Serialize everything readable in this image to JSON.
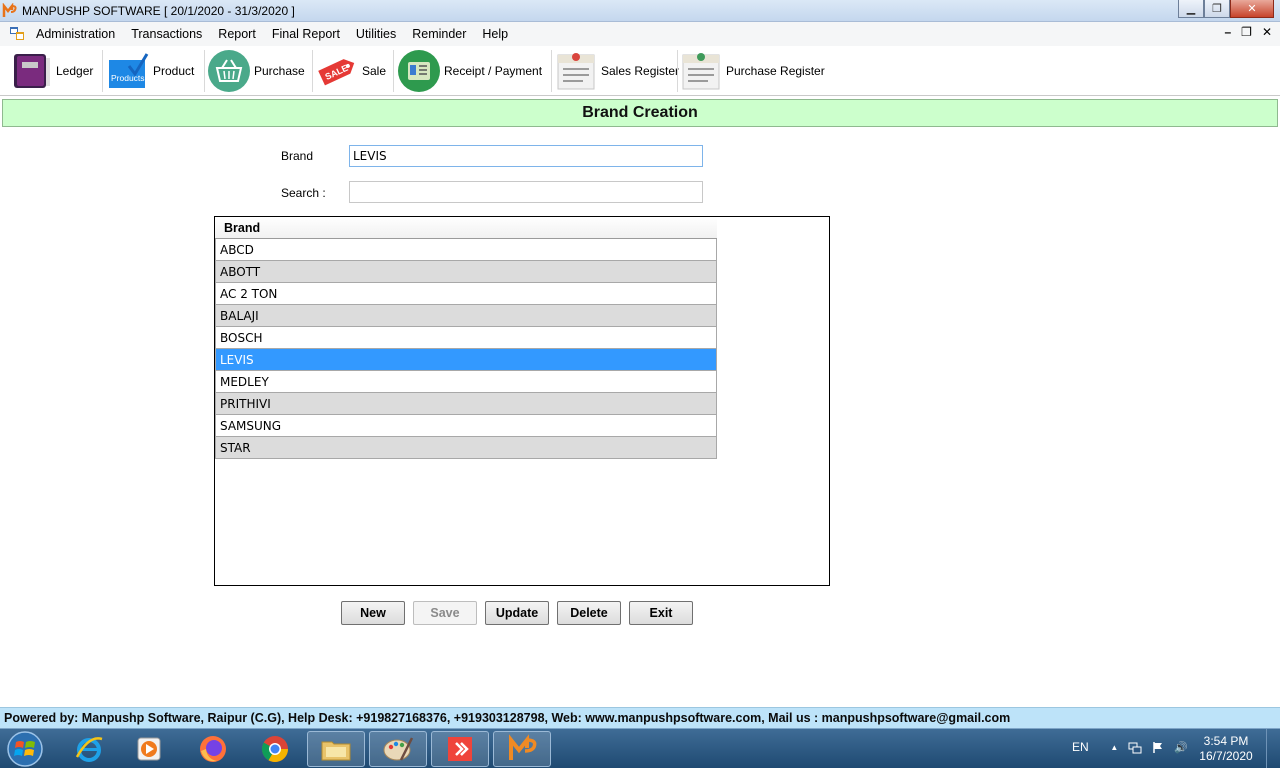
{
  "window": {
    "title": "MANPUSHP SOFTWARE [ 20/1/2020 - 31/3/2020 ]",
    "minimize": "▁",
    "restore": "❐",
    "close": "✕"
  },
  "menu": {
    "items": [
      "Administration",
      "Transactions",
      "Report",
      "Final Report",
      "Utilities",
      "Reminder",
      "Help"
    ],
    "mdi_min": "–",
    "mdi_restore": "❐",
    "mdi_close": "✕"
  },
  "toolbar": {
    "ledger": "Ledger",
    "product": "Product",
    "product_icon_text": "Products",
    "purchase": "Purchase",
    "sale": "Sale",
    "sale_icon_text": "SALE",
    "receipt_payment": "Receipt / Payment",
    "sales_register": "Sales Register",
    "purchase_register": "Purchase Register"
  },
  "form": {
    "header": "Brand Creation",
    "brand_label": "Brand",
    "brand_value": "LEVIS",
    "search_label": "Search :",
    "search_value": ""
  },
  "grid": {
    "column": "Brand",
    "rows": [
      "ABCD",
      "ABOTT",
      "AC 2  TON",
      "BALAJI",
      "BOSCH",
      "LEVIS",
      "MEDLEY",
      "PRITHIVI",
      "SAMSUNG",
      "STAR"
    ],
    "selected": "LEVIS"
  },
  "buttons": {
    "new": "New",
    "save": "Save",
    "update": "Update",
    "delete": "Delete",
    "exit": "Exit"
  },
  "status": {
    "text": "Powered by: Manpushp Software, Raipur (C.G), Help Desk: +919827168376, +919303128798, Web: www.manpushpsoftware.com,  Mail us :  manpushpsoftware@gmail.com"
  },
  "taskbar": {
    "language": "EN",
    "time": "3:54 PM",
    "date": "16/7/2020",
    "tray_arrow": "▲",
    "volume_icon_glyph": "🔊",
    "apps": [
      "windows-start-icon",
      "internet-explorer-icon",
      "media-player-icon",
      "firefox-icon",
      "chrome-icon",
      "file-explorer-icon",
      "paint-icon",
      "anydesk-icon",
      "manpushp-app-icon"
    ]
  },
  "colors": {
    "header_band": "#ccffcc",
    "selection": "#3399ff",
    "status_bar": "#bde3f9",
    "taskbar": "#2b5580"
  }
}
